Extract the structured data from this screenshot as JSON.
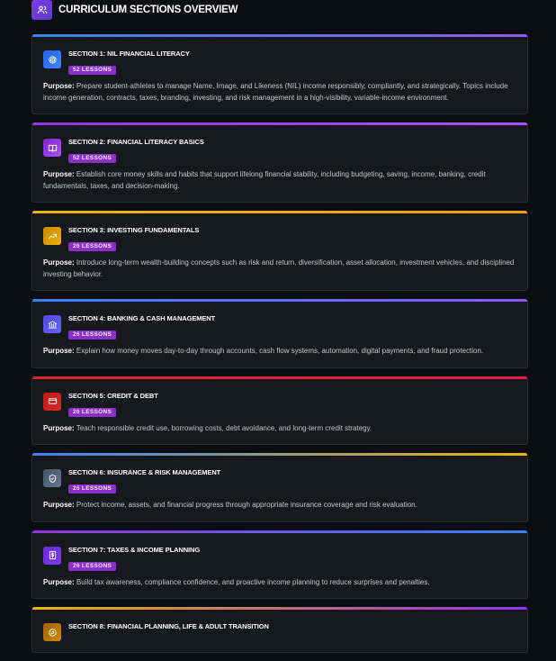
{
  "header": {
    "title": "CURRICULUM SECTIONS OVERVIEW",
    "icon": "users-icon"
  },
  "purpose_label": "Purpose:",
  "sections": [
    {
      "title": "SECTION 1: NIL FINANCIAL LITERACY",
      "badge": "52 LESSONS",
      "icon": "target-icon",
      "text": "Prepare student-athletes to manage Name, Image, and Likeness (NIL) income responsibly, compliantly, and strategically. Topics include income generation, contracts, taxes, branding, investing, and risk management in a high-visibility, variable-income environment.",
      "bar": "linear-gradient(90deg,#3b82f6,#8b5cf6)",
      "icon_bg": "linear-gradient(135deg,#2563eb,#3b82f6)"
    },
    {
      "title": "SECTION 2: FINANCIAL LITERACY BASICS",
      "badge": "52 LESSONS",
      "icon": "book-icon",
      "text": "Establish core money skills and habits that support lifelong financial stability, including budgeting, saving, income, banking, credit fundamentals, taxes, and decision-making.",
      "bar": "linear-gradient(90deg,#9333ea,#a855f7)",
      "icon_bg": "linear-gradient(135deg,#7e22ce,#a855f7)"
    },
    {
      "title": "SECTION 3: INVESTING FUNDAMENTALS",
      "badge": "26 LESSONS",
      "icon": "trending-up-icon",
      "text": "Introduce long-term wealth-building concepts such as risk and return, diversification, asset allocation, investment vehicles, and disciplined investing behavior.",
      "bar": "linear-gradient(90deg,#eab308,#f59e0b)",
      "icon_bg": "linear-gradient(135deg,#ca8a04,#eab308)"
    },
    {
      "title": "SECTION 4: BANKING & CASH MANAGEMENT",
      "badge": "26 LESSONS",
      "icon": "bank-icon",
      "text": "Explain how money moves day-to-day through accounts, cash flow systems, automation, digital payments, and fraud protection.",
      "bar": "linear-gradient(90deg,#3b82f6,#8b5cf6)",
      "icon_bg": "linear-gradient(135deg,#4f46e5,#6366f1)"
    },
    {
      "title": "SECTION 5: CREDIT & DEBT",
      "badge": "26 LESSONS",
      "icon": "credit-card-icon",
      "text": "Teach responsible credit use, borrowing costs, debt avoidance, and long-term credit strategy.",
      "bar": "linear-gradient(90deg,#dc2626,#e11d48)",
      "icon_bg": "linear-gradient(135deg,#b91c1c,#dc2626)"
    },
    {
      "title": "SECTION 6: INSURANCE & RISK MANAGEMENT",
      "badge": "26 LESSONS",
      "icon": "shield-icon",
      "text": "Protect income, assets, and financial progress through appropriate insurance coverage and risk evaluation.",
      "bar": "linear-gradient(90deg,#3b82f6,#eab308)",
      "icon_bg": "linear-gradient(135deg,#475569,#64748b)"
    },
    {
      "title": "SECTION 7: TAXES & INCOME PLANNING",
      "badge": "26 LESSONS",
      "icon": "receipt-icon",
      "text": "Build tax awareness, compliance confidence, and proactive income planning to reduce surprises and penalties.",
      "bar": "linear-gradient(90deg,#9333ea,#3b82f6)",
      "icon_bg": "linear-gradient(135deg,#6d28d9,#7c3aed)"
    },
    {
      "title": "SECTION 8: FINANCIAL PLANNING, LIFE & ADULT TRANSITION",
      "badge": "",
      "icon": "compass-icon",
      "text": "",
      "bar": "linear-gradient(90deg,#eab308,#9333ea)",
      "icon_bg": "linear-gradient(135deg,#a16207,#ca8a04)"
    }
  ]
}
